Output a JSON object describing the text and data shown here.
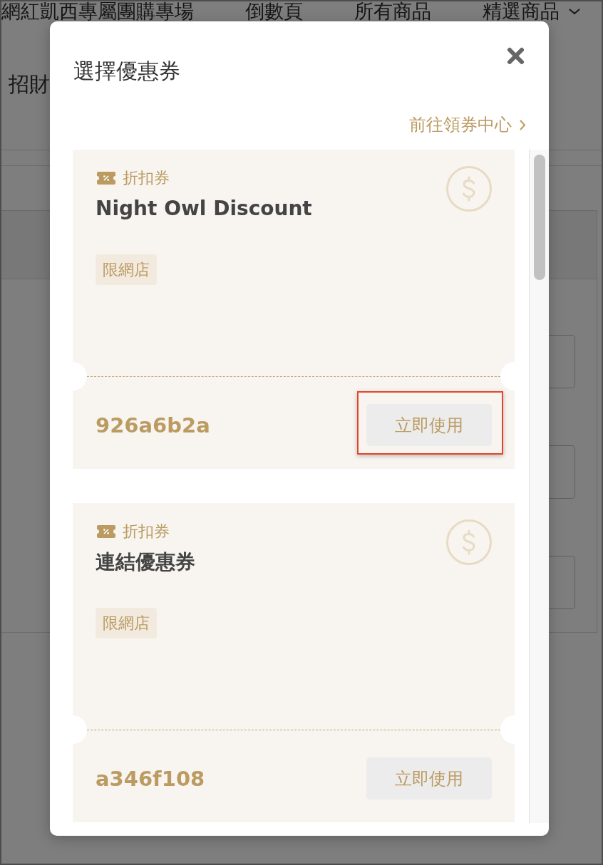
{
  "background_page": {
    "nav": [
      {
        "label": "網紅凱西專屬團購專場",
        "dropdown": false
      },
      {
        "label": "倒數頁",
        "dropdown": false
      },
      {
        "label": "所有商品",
        "dropdown": false
      },
      {
        "label": "精選商品",
        "dropdown": true
      }
    ],
    "section_title": "招財"
  },
  "dialog": {
    "title": "選擇優惠券",
    "link": "前往領券中心",
    "coupons": [
      {
        "type": "折扣券",
        "name": "Night Owl Discount",
        "tag": "限網店",
        "code": "926a6b2a",
        "button": "立即使用",
        "highlighted": true
      },
      {
        "type": "折扣券",
        "name": "連結優惠券",
        "tag": "限網店",
        "code": "a346f108",
        "button": "立即使用",
        "highlighted": false
      }
    ]
  }
}
